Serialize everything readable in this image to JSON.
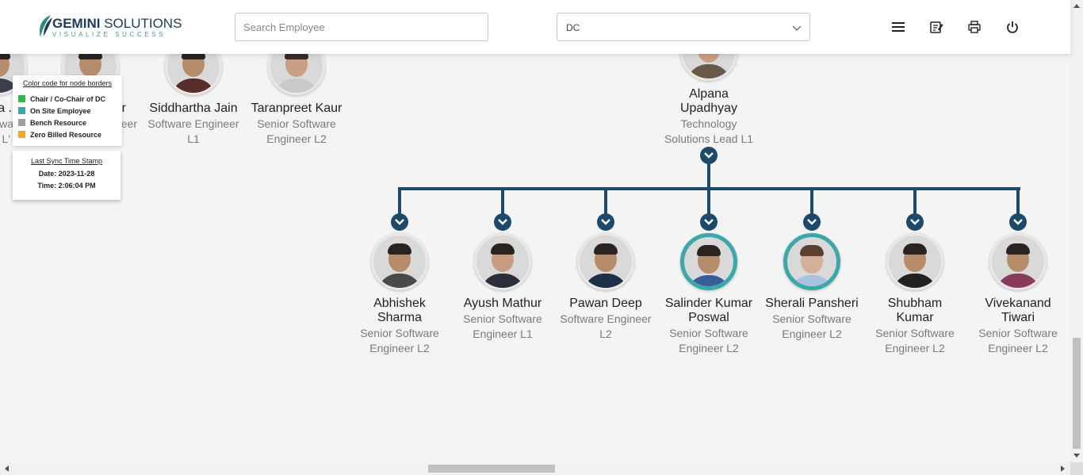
{
  "header": {
    "brand_name_bold": "GEMINI",
    "brand_name_light": " SOLUTIONS",
    "brand_tagline": "VISUALIZE SUCCESS",
    "search_placeholder": "Search Employee",
    "department_selected": "DC"
  },
  "legend": {
    "title": "Color code for node borders",
    "items": [
      {
        "label": "Chair / Co-Chair of DC",
        "color": "#2db84a"
      },
      {
        "label": "On Site Employee",
        "color": "#3aa8a8"
      },
      {
        "label": "Bench Resource",
        "color": "#9e9e9e"
      },
      {
        "label": "Zero Billed Resource",
        "color": "#f5a623"
      }
    ]
  },
  "sync": {
    "title": "Last Sync Time Stamp",
    "date": "Date: 2023-11-28",
    "time": "Time: 2:06:04 PM"
  },
  "top_row_partial": [
    {
      "name": "a .",
      "title1": "twa",
      "title2": "r L'"
    },
    {
      "name": "r",
      "title1": "eer",
      "title2": ""
    },
    {
      "name": "Siddhartha Jain",
      "title1": "Software Engineer",
      "title2": "L1"
    },
    {
      "name": "Taranpreet Kaur",
      "title1": "Senior Software",
      "title2": "Engineer L2"
    }
  ],
  "manager": {
    "name1": "Alpana",
    "name2": "Upadhyay",
    "title1": "Technology",
    "title2": "Solutions Lead L1"
  },
  "reports": [
    {
      "name1": "Abhishek",
      "name2": "Sharma",
      "title1": "Senior Software",
      "title2": "Engineer L2",
      "border": "default"
    },
    {
      "name1": "Ayush Mathur",
      "name2": "",
      "title1": "Senior Software",
      "title2": "Engineer L1",
      "border": "default"
    },
    {
      "name1": "Pawan Deep",
      "name2": "",
      "title1": "Software Engineer",
      "title2": "L2",
      "border": "default"
    },
    {
      "name1": "Salinder Kumar",
      "name2": "Poswal",
      "title1": "Senior Software",
      "title2": "Engineer L2",
      "border": "onsite"
    },
    {
      "name1": "Sherali Pansheri",
      "name2": "",
      "title1": "Senior Software",
      "title2": "Engineer L2",
      "border": "onsite"
    },
    {
      "name1": "Shubham",
      "name2": "Kumar",
      "title1": "Senior Software",
      "title2": "Engineer L2",
      "border": "default"
    },
    {
      "name1": "Vivekanand",
      "name2": "Tiwari",
      "title1": "Senior Software",
      "title2": "Engineer L2",
      "border": "default"
    }
  ],
  "icons": {
    "menu": "hamburger-menu-icon",
    "notes": "notes-icon",
    "print": "print-icon",
    "logout": "power-icon",
    "expand": "chevron-down-icon"
  },
  "colors": {
    "connector": "#1d4a6b",
    "onsite_border": "#3aa8a8",
    "brand_navy": "#1d3c5a",
    "brand_teal": "#4a9a8e"
  }
}
